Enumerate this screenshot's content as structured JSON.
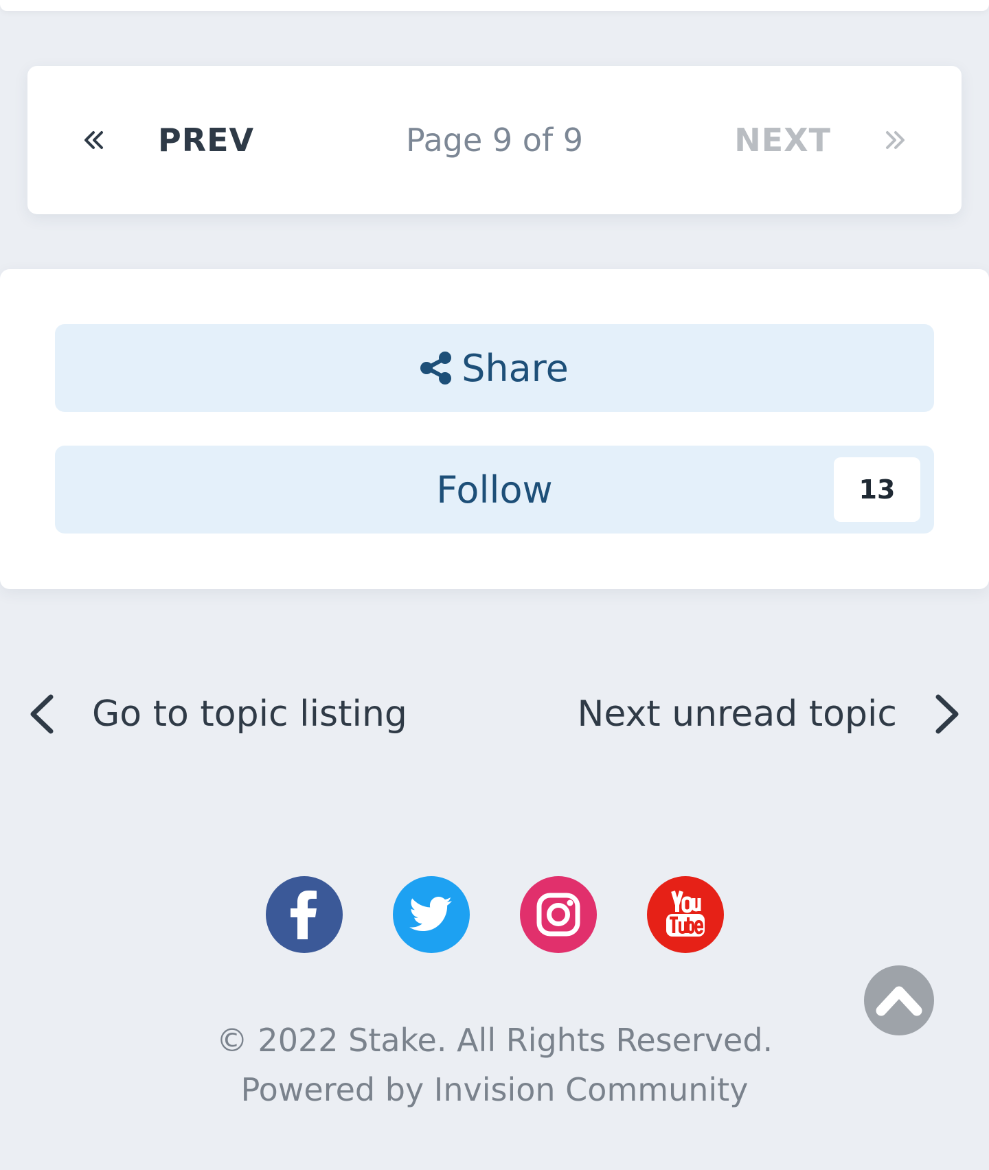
{
  "pagination": {
    "prev_label": "PREV",
    "page_text": "Page 9 of 9",
    "next_label": "NEXT",
    "prev_icon": "double-chevron-left-icon",
    "next_icon": "double-chevron-right-icon"
  },
  "actions": {
    "share_label": "Share",
    "share_icon": "share-icon",
    "follow_label": "Follow",
    "follow_count": "13"
  },
  "topic_nav": {
    "back_label": "Go to topic listing",
    "next_label": "Next unread topic"
  },
  "social": [
    {
      "name": "facebook",
      "color": "#3b5998"
    },
    {
      "name": "twitter",
      "color": "#1da1f2"
    },
    {
      "name": "instagram",
      "color": "#e1306c"
    },
    {
      "name": "youtube",
      "color": "#e62117"
    }
  ],
  "footer": {
    "copyright": "© 2022 Stake. All Rights Reserved.",
    "powered_by": "Powered by Invision Community"
  },
  "colors": {
    "page_bg": "#ebeef3",
    "button_bg": "#e4f0fa",
    "button_text": "#1d4f78",
    "scroll_top_bg": "#9ea3a9"
  }
}
